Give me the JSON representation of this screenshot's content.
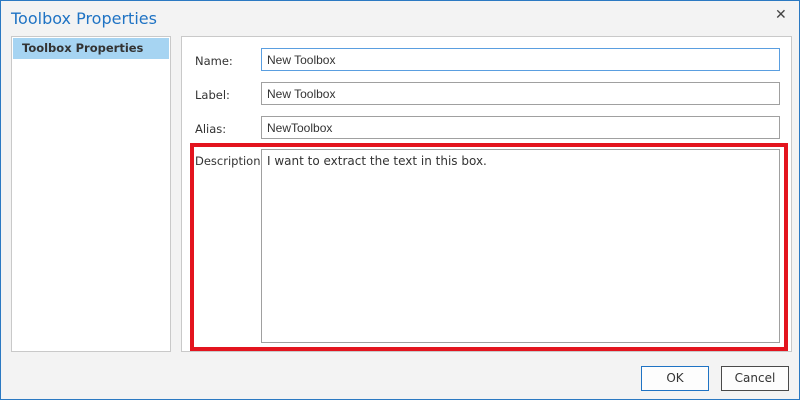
{
  "dialog": {
    "title": "Toolbox Properties",
    "close_icon": "close-icon"
  },
  "nav": {
    "items": [
      {
        "label": "Toolbox Properties",
        "selected": true
      }
    ]
  },
  "form": {
    "name": {
      "label": "Name:",
      "value": "New Toolbox"
    },
    "label": {
      "label": "Label:",
      "value": "New Toolbox"
    },
    "alias": {
      "label": "Alias:",
      "value": "NewToolbox"
    },
    "description": {
      "label": "Description:",
      "value": "I want to extract the text in this box."
    }
  },
  "buttons": {
    "ok": "OK",
    "cancel": "Cancel"
  },
  "colors": {
    "accent": "#1f73c4",
    "selection": "#a6d4f2",
    "highlight": "#e3141e"
  }
}
